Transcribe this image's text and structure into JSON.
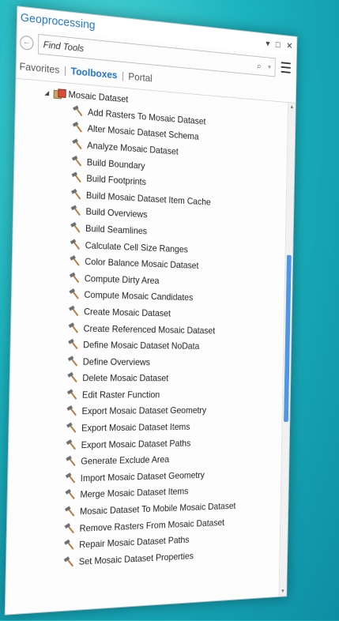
{
  "window": {
    "title": "Geoprocessing",
    "controls": [
      "▾",
      "□",
      "✕"
    ]
  },
  "search": {
    "placeholder": "Find Tools",
    "back_icon": "back-arrow-icon",
    "search_icon": "search-icon",
    "menu_icon": "hamburger-menu-icon"
  },
  "tabs": [
    {
      "label": "Favorites",
      "active": false
    },
    {
      "label": "Toolboxes",
      "active": true
    },
    {
      "label": "Portal",
      "active": false
    }
  ],
  "tree": {
    "root_label": "Mosaic Dataset",
    "items": [
      "Add Rasters To Mosaic Dataset",
      "Alter Mosaic Dataset Schema",
      "Analyze Mosaic Dataset",
      "Build Boundary",
      "Build Footprints",
      "Build Mosaic Dataset Item Cache",
      "Build Overviews",
      "Build Seamlines",
      "Calculate Cell Size Ranges",
      "Color Balance Mosaic Dataset",
      "Compute Dirty Area",
      "Compute Mosaic Candidates",
      "Create Mosaic Dataset",
      "Create Referenced Mosaic Dataset",
      "Define Mosaic Dataset NoData",
      "Define Overviews",
      "Delete Mosaic Dataset",
      "Edit Raster Function",
      "Export Mosaic Dataset Geometry",
      "Export Mosaic Dataset Items",
      "Export Mosaic Dataset Paths",
      "Generate Exclude Area",
      "Import Mosaic Dataset Geometry",
      "Merge Mosaic Dataset Items",
      "Mosaic Dataset To Mobile Mosaic Dataset",
      "Remove Rasters From Mosaic Dataset",
      "Repair Mosaic Dataset Paths",
      "Set Mosaic Dataset Properties"
    ]
  },
  "colors": {
    "accent": "#1f74c9",
    "scroll_thumb": "#4f97e3",
    "background": "#1bb3bf"
  }
}
